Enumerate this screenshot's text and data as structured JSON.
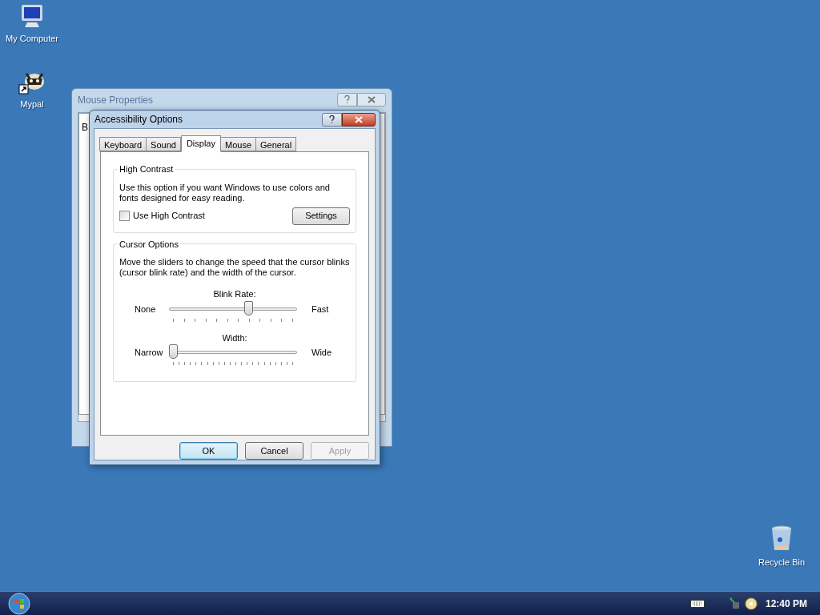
{
  "desktop_icons": [
    {
      "kind": "computer",
      "label": "My Computer"
    },
    {
      "kind": "app-shortcut",
      "label": "Mypal"
    },
    {
      "kind": "recycle-bin",
      "label": "Recycle Bin"
    }
  ],
  "background_window": {
    "title": "Mouse Properties",
    "content_fragment": "B"
  },
  "dialog": {
    "title": "Accessibility Options",
    "tabs": [
      {
        "label": "Keyboard",
        "selected": false
      },
      {
        "label": "Sound",
        "selected": false
      },
      {
        "label": "Display",
        "selected": true
      },
      {
        "label": "Mouse",
        "selected": false
      },
      {
        "label": "General",
        "selected": false
      }
    ],
    "high_contrast": {
      "title": "High Contrast",
      "description": "Use this option if you want Windows to use colors and fonts designed for easy reading.",
      "checkbox": {
        "label": "Use High Contrast",
        "checked": false
      },
      "button": "Settings"
    },
    "cursor_options": {
      "title": "Cursor Options",
      "description": "Move the sliders to change the speed that the cursor blinks (cursor blink rate) and the width of the cursor.",
      "sliders": [
        {
          "label": "Blink Rate:",
          "min_label": "None",
          "max_label": "Fast",
          "level": 0.63
        },
        {
          "label": "Width:",
          "min_label": "Narrow",
          "max_label": "Wide",
          "level": 0
        }
      ]
    },
    "buttons": [
      {
        "label": "OK",
        "default": true,
        "disabled": false
      },
      {
        "label": "Cancel",
        "default": false,
        "disabled": false
      },
      {
        "label": "Apply",
        "default": false,
        "disabled": true
      }
    ]
  },
  "taskbar": {
    "clock": "12:40 PM"
  }
}
